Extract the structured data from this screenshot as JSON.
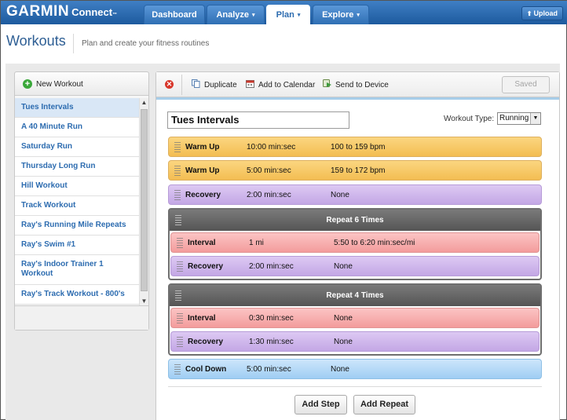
{
  "brand": {
    "name": "GARMIN",
    "product": "Connect",
    "tm": "™"
  },
  "nav": {
    "tabs": [
      {
        "label": "Dashboard",
        "has_menu": false,
        "active": false
      },
      {
        "label": "Analyze",
        "has_menu": true,
        "active": false
      },
      {
        "label": "Plan",
        "has_menu": true,
        "active": true
      },
      {
        "label": "Explore",
        "has_menu": true,
        "active": false
      }
    ],
    "upload_label": "Upload",
    "caret": "▾",
    "upload_arrow": "⬆"
  },
  "page": {
    "title": "Workouts",
    "subtitle": "Plan and create your fitness routines"
  },
  "sidebar": {
    "new_workout_label": "New Workout",
    "items": [
      {
        "label": "Tues Intervals",
        "active": true
      },
      {
        "label": "A 40 Minute Run"
      },
      {
        "label": "Saturday Run"
      },
      {
        "label": "Thursday Long Run"
      },
      {
        "label": "Hill Workout"
      },
      {
        "label": "Track Workout"
      },
      {
        "label": "Ray's Running Mile Repeats"
      },
      {
        "label": "Ray's Swim #1"
      },
      {
        "label": "Ray's Indoor Trainer 1 Workout"
      },
      {
        "label": "Ray's Track Workout - 800's"
      }
    ]
  },
  "toolbar": {
    "delete_glyph": "✕",
    "duplicate_label": "Duplicate",
    "add_to_calendar_label": "Add to Calendar",
    "send_to_device_label": "Send to Device",
    "saved_label": "Saved"
  },
  "workout": {
    "name": "Tues Intervals",
    "type_label": "Workout Type:",
    "type_value": "Running",
    "steps": [
      {
        "kind": "warm",
        "name": "Warm Up",
        "duration": "10:00 min:sec",
        "target": "100 to 159 bpm"
      },
      {
        "kind": "warm",
        "name": "Warm Up",
        "duration": "5:00 min:sec",
        "target": "159 to 172 bpm"
      },
      {
        "kind": "rec",
        "name": "Recovery",
        "duration": "2:00 min:sec",
        "target": "None"
      }
    ],
    "repeats": [
      {
        "title": "Repeat 6 Times",
        "steps": [
          {
            "kind": "int",
            "name": "Interval",
            "duration": "1 mi",
            "target": "5:50 to 6:20 min:sec/mi"
          },
          {
            "kind": "rec",
            "name": "Recovery",
            "duration": "2:00 min:sec",
            "target": "None"
          }
        ]
      },
      {
        "title": "Repeat 4 Times",
        "steps": [
          {
            "kind": "int",
            "name": "Interval",
            "duration": "0:30 min:sec",
            "target": "None"
          },
          {
            "kind": "rec",
            "name": "Recovery",
            "duration": "1:30 min:sec",
            "target": "None"
          }
        ]
      }
    ],
    "cooldown": {
      "kind": "cool",
      "name": "Cool Down",
      "duration": "5:00 min:sec",
      "target": "None"
    }
  },
  "actions": {
    "add_step_label": "Add Step",
    "add_repeat_label": "Add Repeat"
  },
  "colors": {
    "nav_blue": "#2d6cb0",
    "warm": "#f3bd52",
    "recovery": "#c3a7e5",
    "interval": "#f39c9c",
    "cooldown": "#9fcdf3",
    "repeat_header": "#555555"
  }
}
